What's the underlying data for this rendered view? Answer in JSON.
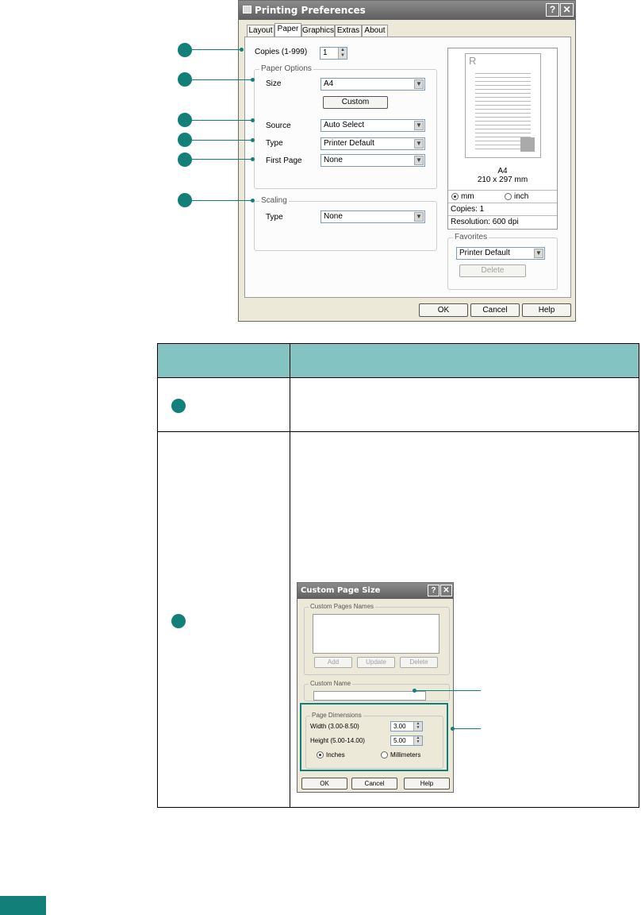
{
  "window": {
    "title": "Printing Preferences",
    "help_button": "?",
    "close_button": "✕",
    "tabs": [
      "Layout",
      "Paper",
      "Graphics",
      "Extras",
      "About"
    ],
    "active_tab": "Paper"
  },
  "paper": {
    "copies_label": "Copies (1-999)",
    "copies_value": "1",
    "paper_options_label": "Paper Options",
    "size_label": "Size",
    "size_value": "A4",
    "custom_button": "Custom",
    "source_label": "Source",
    "source_value": "Auto Select",
    "type_label": "Type",
    "type_value": "Printer Default",
    "first_page_label": "First Page",
    "first_page_value": "None",
    "scaling_label": "Scaling",
    "scaling_type_label": "Type",
    "scaling_type_value": "None"
  },
  "preview": {
    "paper_letter": "R",
    "paper_name": "A4",
    "paper_dims": "210 x 297 mm",
    "unit_mm": "mm",
    "unit_inch": "inch",
    "copies": "Copies: 1",
    "resolution": "Resolution: 600 dpi"
  },
  "favorites": {
    "label": "Favorites",
    "value": "Printer Default",
    "delete_button": "Delete"
  },
  "footer": {
    "ok": "OK",
    "cancel": "Cancel",
    "help": "Help"
  },
  "custom_dialog": {
    "title": "Custom Page Size",
    "help_button": "?",
    "close_button": "✕",
    "names_group": "Custom Pages Names",
    "add": "Add",
    "update": "Update",
    "delete": "Delete",
    "custom_name_group": "Custom Name",
    "dimensions_group": "Page Dimensions",
    "width_label": "Width (3.00-8.50)",
    "width_value": "3.00",
    "height_label": "Height (5.00-14.00)",
    "height_value": "5.00",
    "inches": "Inches",
    "millimeters": "Millimeters",
    "ok": "OK",
    "cancel": "Cancel",
    "help": "Help"
  },
  "colors": {
    "accent": "#137f79",
    "table_header": "#83c4c2",
    "dialog_bg": "#ece9d8"
  }
}
